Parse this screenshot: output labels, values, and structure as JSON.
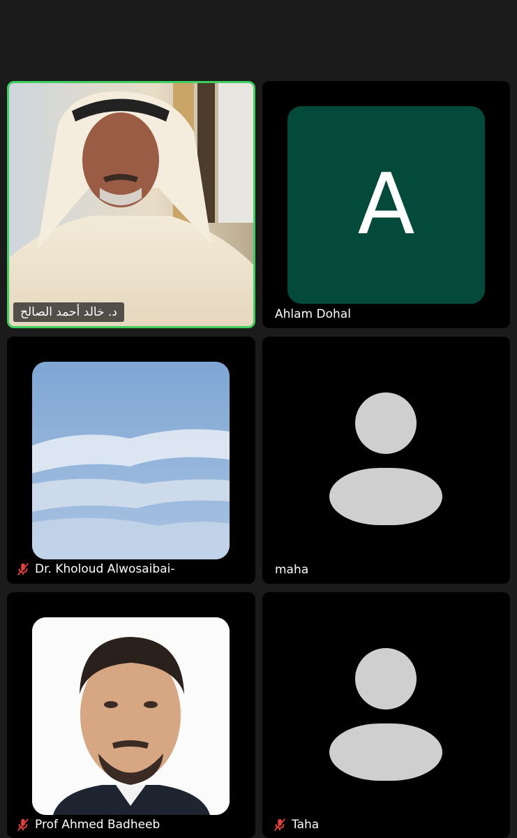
{
  "accent": {
    "active_speaker_border": "#3ecf5f",
    "letter_avatar_bg": "#034a3a",
    "muted_icon": "#e0423a"
  },
  "participants": [
    {
      "name": "د. خالد أحمد الصالح",
      "muted": false,
      "active": true,
      "video": "camera-feed"
    },
    {
      "name": "Ahlam Dohal",
      "muted": false,
      "active": false,
      "video": "letter-avatar",
      "initial": "A"
    },
    {
      "name": "Dr. Kholoud Alwosaibai-",
      "muted": true,
      "active": false,
      "video": "profile-photo-sky"
    },
    {
      "name": "maha",
      "muted": false,
      "active": false,
      "video": "placeholder-avatar"
    },
    {
      "name": "Prof Ahmed Badheeb",
      "muted": true,
      "active": false,
      "video": "profile-photo-portrait"
    },
    {
      "name": "Taha",
      "muted": true,
      "active": false,
      "video": "placeholder-avatar"
    }
  ]
}
